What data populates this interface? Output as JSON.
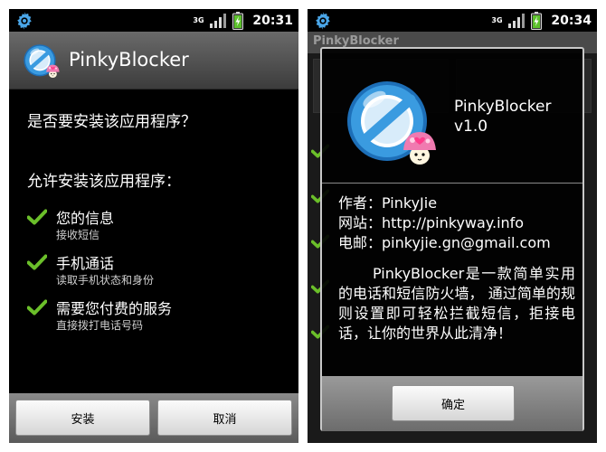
{
  "left_screen": {
    "status": {
      "network": "3G",
      "time": "20:31"
    },
    "title": "PinkyBlocker",
    "question": "是否要安装该应用程序？",
    "permissions_heading": "允许安装该应用程序：",
    "permissions": [
      {
        "title": "您的信息",
        "detail": "接收短信"
      },
      {
        "title": "手机通话",
        "detail": "读取手机状态和身份"
      },
      {
        "title": "需要您付费的服务",
        "detail": "直接拨打电话号码"
      }
    ],
    "install_label": "安装",
    "cancel_label": "取消"
  },
  "right_screen": {
    "status": {
      "network": "3G",
      "time": "20:34"
    },
    "background_title": "PinkyBlocker",
    "dialog": {
      "app_name": "PinkyBlocker",
      "version": "v1.0",
      "author": "作者：PinkyJie",
      "website": "网站：http://pinkyway.info",
      "email": "电邮：pinkyjie.gn@gmail.com",
      "description": "PinkyBlocker是一款简单实用的电话和短信防火墙， 通过简单的规则设置即可轻松拦截短信，拒接电话，让你的世界从此清净！",
      "ok_label": "确定"
    }
  },
  "colors": {
    "check_green": "#6bbf2a",
    "logo_blue": "#2a8fd8",
    "mushroom_pink": "#f07ab0"
  },
  "icons": [
    "gear-icon",
    "signal-icon",
    "battery-icon",
    "check-icon",
    "app-logo-icon"
  ]
}
